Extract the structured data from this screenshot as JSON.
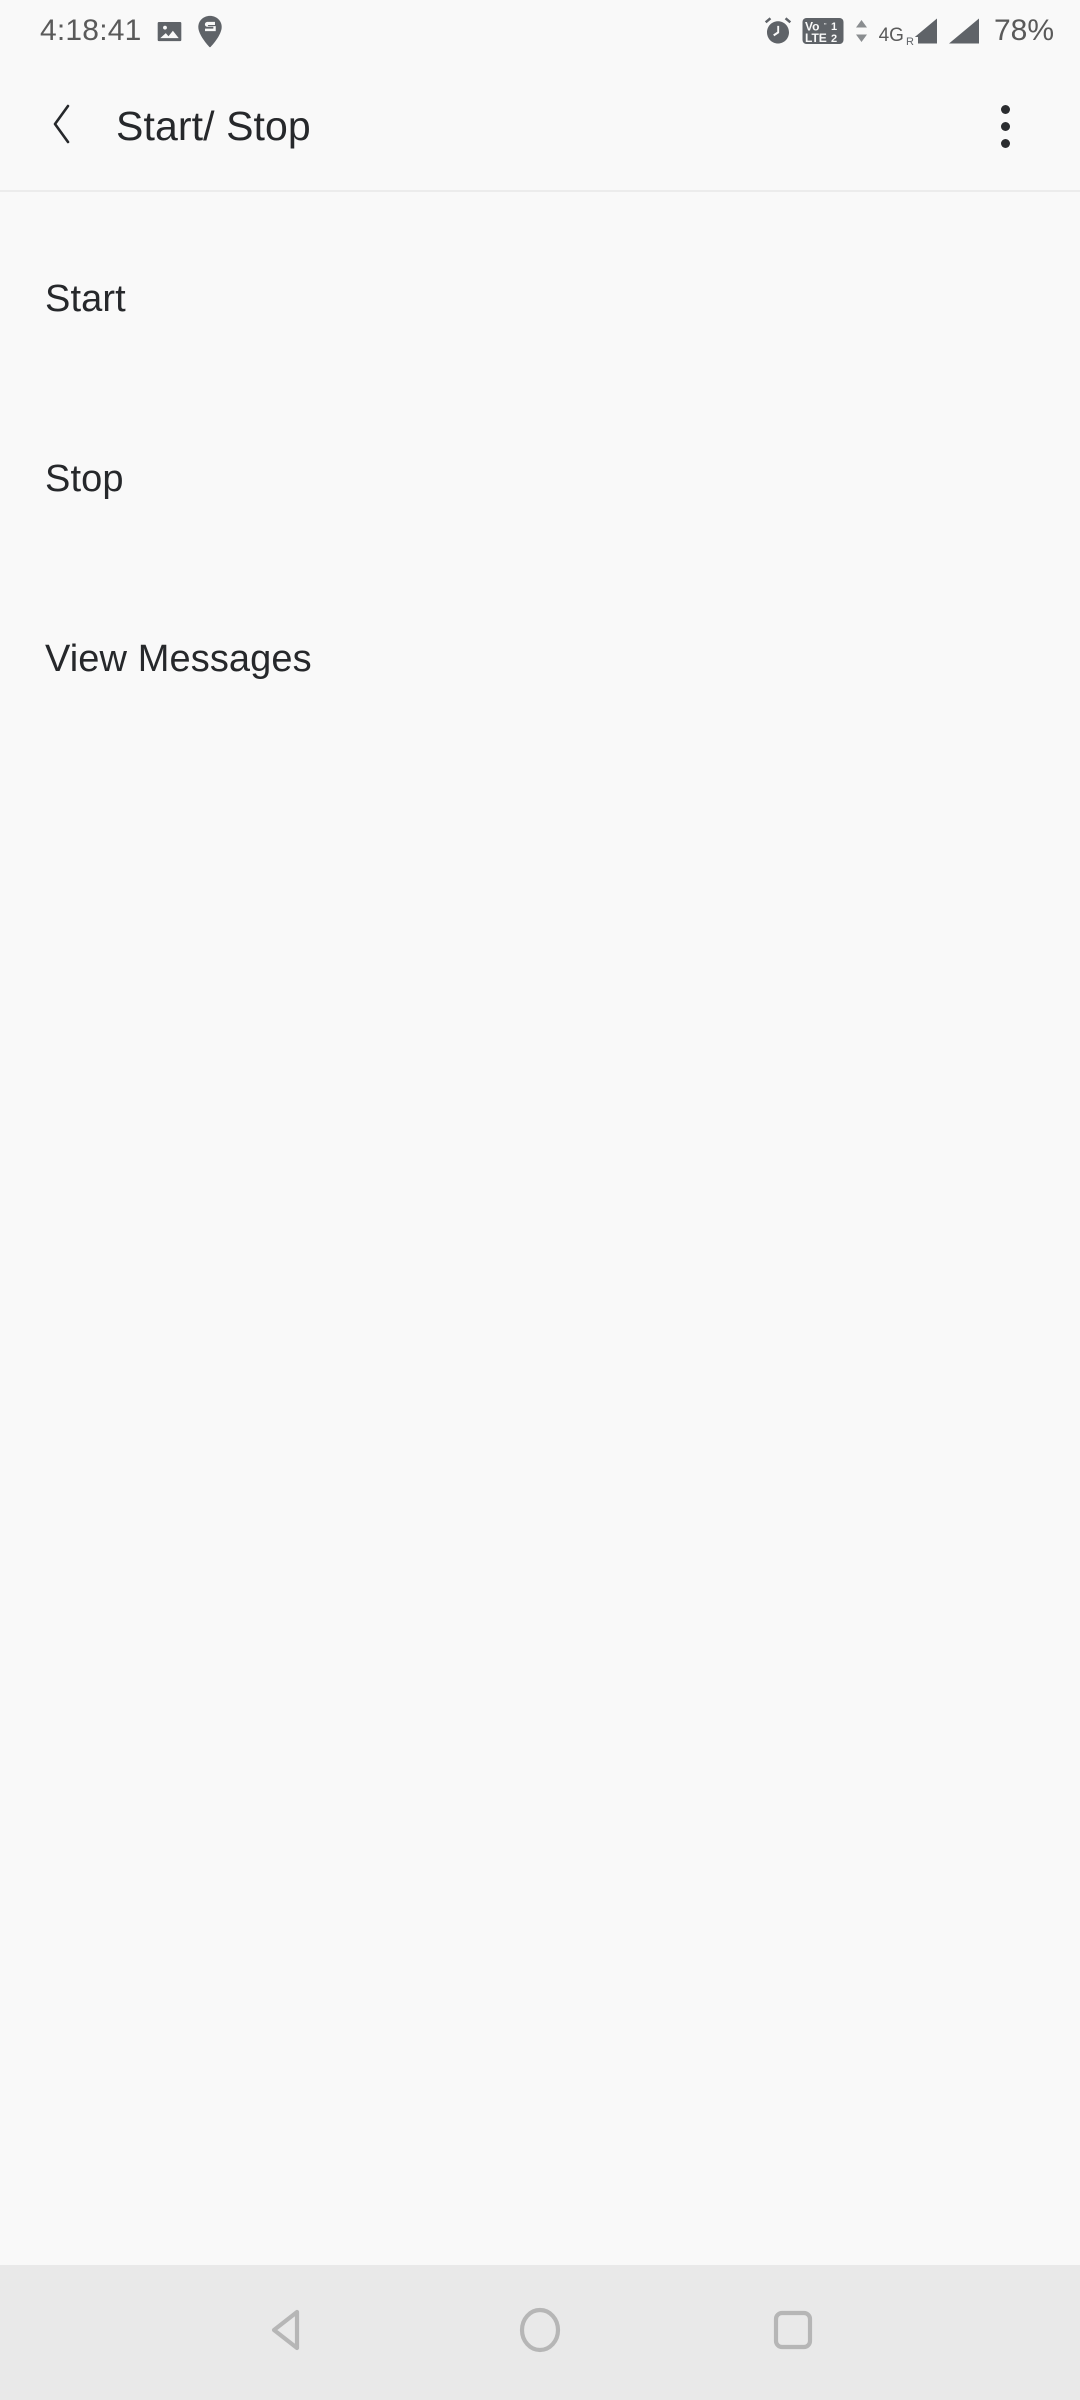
{
  "status_bar": {
    "clock": "4:18:41",
    "battery": "78%",
    "network_type": "4G",
    "volte_labels": {
      "primary": "1",
      "secondary": "2",
      "tech": "VoLTE"
    },
    "roaming_label": "R",
    "icons": [
      "gallery-icon",
      "location-pin-icon",
      "alarm-icon",
      "volte-dual-sim-icon",
      "data-transfer-arrows-icon",
      "signal-bars-sim1-icon",
      "signal-bars-sim2-icon"
    ]
  },
  "app_bar": {
    "title": "Start/ Stop",
    "back_icon": "chevron-left-icon",
    "overflow_icon": "more-vertical-icon"
  },
  "list": {
    "items": [
      {
        "label": "Start"
      },
      {
        "label": "Stop"
      },
      {
        "label": "View Messages"
      }
    ]
  },
  "nav_bar": {
    "back": "back-triangle-icon",
    "home": "home-circle-icon",
    "recents": "recents-square-icon"
  },
  "colors": {
    "background": "#f9f9f9",
    "text_primary": "#26282b",
    "text_status": "#5a5a5a",
    "divider": "#ececec",
    "navbar_bg": "#e9e9e9",
    "navbar_icon": "#b6b6b6"
  }
}
